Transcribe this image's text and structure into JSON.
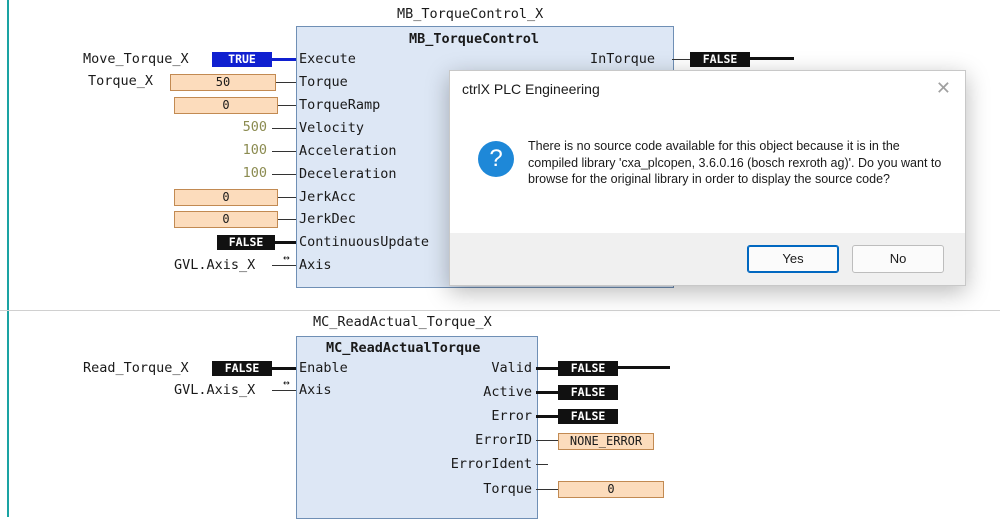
{
  "block1": {
    "instance_name": "MB_TorqueControl_X",
    "type_name": "MB_TorqueControl",
    "inputs": [
      {
        "pin": "Execute",
        "var": "Move_Torque_X",
        "value": "TRUE"
      },
      {
        "pin": "Torque",
        "var": "Torque_X",
        "value": "50"
      },
      {
        "pin": "TorqueRamp",
        "value": "0"
      },
      {
        "pin": "Velocity",
        "const": "500"
      },
      {
        "pin": "Acceleration",
        "const": "100"
      },
      {
        "pin": "Deceleration",
        "const": "100"
      },
      {
        "pin": "JerkAcc",
        "value": "0"
      },
      {
        "pin": "JerkDec",
        "value": "0"
      },
      {
        "pin": "ContinuousUpdate",
        "value": "FALSE"
      },
      {
        "pin": "Axis",
        "var": "GVL.Axis_X",
        "ref": "↔"
      }
    ],
    "outputs": [
      {
        "pin": "InTorque",
        "value": "FALSE"
      }
    ]
  },
  "block2": {
    "instance_name": "MC_ReadActual_Torque_X",
    "type_name": "MC_ReadActualTorque",
    "inputs": [
      {
        "pin": "Enable",
        "var": "Read_Torque_X",
        "value": "FALSE"
      },
      {
        "pin": "Axis",
        "var": "GVL.Axis_X",
        "ref": "↔"
      }
    ],
    "outputs": [
      {
        "pin": "Valid",
        "value": "FALSE"
      },
      {
        "pin": "Active",
        "value": "FALSE"
      },
      {
        "pin": "Error",
        "value": "FALSE"
      },
      {
        "pin": "ErrorID",
        "value": "NONE_ERROR"
      },
      {
        "pin": "ErrorIdent",
        "value": ""
      },
      {
        "pin": "Torque",
        "value": "0"
      }
    ]
  },
  "dialog": {
    "title": "ctrlX PLC Engineering",
    "close_icon": "close-icon",
    "icon": "?",
    "message": "There is no source code available for this object because it is in the compiled library 'cxa_plcopen, 3.6.0.16 (bosch rexroth ag)'. Do you want to browse for the original library in order to display the source code?",
    "yes_label": "Yes",
    "no_label": "No"
  },
  "colors": {
    "fb_fill": "#dde7f5",
    "value_fill": "#fcdcbc",
    "bool_false": "#111111",
    "bool_true": "#1020d0",
    "dialog_icon": "#1e88d8"
  }
}
